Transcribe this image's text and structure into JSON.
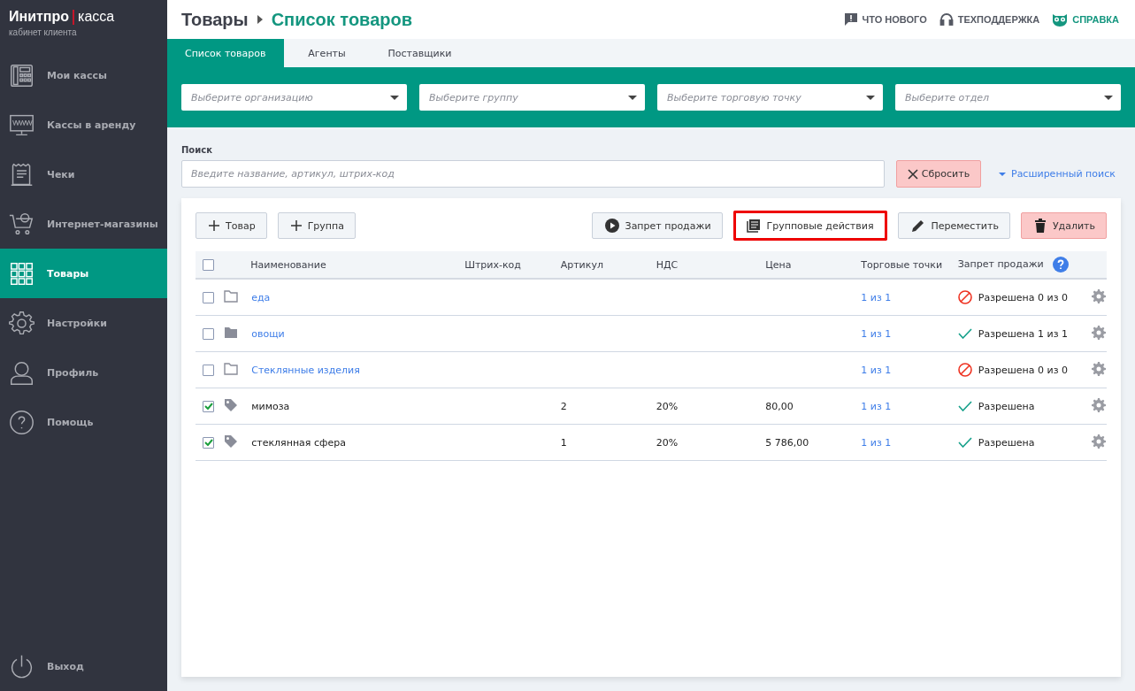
{
  "logo": {
    "brand": "Инитпро",
    "product": "касса",
    "subtitle": "кабинет клиента"
  },
  "sidebar": {
    "items": [
      {
        "label": "Мои кассы",
        "kind": "phone",
        "selected": false
      },
      {
        "label": "Кассы в аренду",
        "kind": "monitor",
        "selected": false
      },
      {
        "label": "Чеки",
        "kind": "receipt",
        "selected": false
      },
      {
        "label": "Интернет-магазины",
        "kind": "cart",
        "selected": false
      },
      {
        "label": "Товары",
        "kind": "grid",
        "selected": true
      },
      {
        "label": "Настройки",
        "kind": "gear",
        "selected": false
      },
      {
        "label": "Профиль",
        "kind": "person",
        "selected": false
      },
      {
        "label": "Помощь",
        "kind": "help",
        "selected": false
      }
    ],
    "logout": "Выход"
  },
  "breadcrumb": {
    "parent": "Товары",
    "current": "Список товаров"
  },
  "header_links": [
    {
      "label": "ЧТО НОВОГО",
      "kind": "message",
      "accent": false
    },
    {
      "label": "ТЕХПОДДЕРЖКА",
      "kind": "headset",
      "accent": false
    },
    {
      "label": "СПРАВКА",
      "kind": "owl",
      "accent": true
    }
  ],
  "tabs": [
    {
      "label": "Список товаров",
      "selected": true
    },
    {
      "label": "Агенты",
      "selected": false
    },
    {
      "label": "Поставщики",
      "selected": false
    }
  ],
  "filters": [
    {
      "placeholder": "Выберите организацию"
    },
    {
      "placeholder": "Выберите группу"
    },
    {
      "placeholder": "Выберите торговую точку"
    },
    {
      "placeholder": "Выберите отдел"
    }
  ],
  "search": {
    "label": "Поиск",
    "placeholder": "Введите название, артикул, штрих-код",
    "reset": "Сбросить",
    "advanced": "Расширенный поиск"
  },
  "toolbar_left": [
    {
      "label": "Товар",
      "kind": "add",
      "highlighted": false
    },
    {
      "label": "Группа",
      "kind": "add",
      "highlighted": false
    }
  ],
  "toolbar_right": [
    {
      "label": "Запрет продажи",
      "kind": "ban",
      "highlighted": false
    },
    {
      "label": "Групповые действия",
      "kind": "bulk",
      "highlighted": true
    },
    {
      "label": "Переместить",
      "kind": "move",
      "highlighted": false
    },
    {
      "label": "Удалить",
      "kind": "delete",
      "highlighted": false
    }
  ],
  "table": {
    "all_checked": false,
    "columns": [
      "Наименование",
      "Штрих-код",
      "Артикул",
      "НДС",
      "Цена",
      "Торговые точки",
      "Запрет продажи"
    ],
    "rows": [
      {
        "kind": "group",
        "empty": true,
        "checked": false,
        "name": "еда",
        "article": "",
        "vat": "",
        "price": "",
        "points": "1 из 1",
        "allowed": false,
        "status": "Разрешена 0 из 0"
      },
      {
        "kind": "group",
        "empty": false,
        "checked": false,
        "name": "овощи",
        "article": "",
        "vat": "",
        "price": "",
        "points": "1 из 1",
        "allowed": true,
        "status": "Разрешена 1 из 1"
      },
      {
        "kind": "group",
        "empty": true,
        "checked": false,
        "name": "Стеклянные изделия",
        "article": "",
        "vat": "",
        "price": "",
        "points": "1 из 1",
        "allowed": false,
        "status": "Разрешена 0 из 0"
      },
      {
        "kind": "product",
        "checked": true,
        "name": "мимоза",
        "article": "2",
        "vat": "20%",
        "price": "80,00",
        "points": "1 из 1",
        "allowed": true,
        "status": "Разрешена"
      },
      {
        "kind": "product",
        "checked": true,
        "name": "стеклянная сфера",
        "article": "1",
        "vat": "20%",
        "price": "5 786,00",
        "points": "1 из 1",
        "allowed": true,
        "status": "Разрешена"
      }
    ]
  }
}
